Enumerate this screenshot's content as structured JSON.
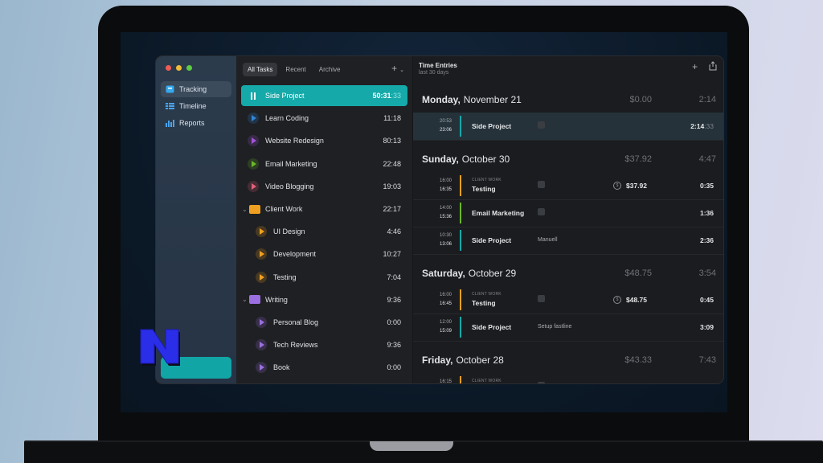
{
  "sidebar": {
    "items": [
      {
        "label": "Tracking",
        "icon": "tracking-icon",
        "active": true
      },
      {
        "label": "Timeline",
        "icon": "timeline-icon",
        "active": false
      },
      {
        "label": "Reports",
        "icon": "reports-icon",
        "active": false
      }
    ]
  },
  "tasks_panel": {
    "tabs": [
      {
        "label": "All Tasks",
        "active": true
      },
      {
        "label": "Recent",
        "active": false
      },
      {
        "label": "Archive",
        "active": false
      }
    ],
    "add_icon": "plus-icon",
    "tasks": [
      {
        "label": "Side Project",
        "time": "50:31",
        "time_sec": ":33",
        "color": "#16a9a9",
        "active": true,
        "type": "task",
        "indent": false
      },
      {
        "label": "Learn Coding",
        "time": "11:18",
        "color": "#2f86d6",
        "type": "task",
        "indent": false
      },
      {
        "label": "Website Redesign",
        "time": "80:13",
        "color": "#a055d6",
        "type": "task",
        "indent": false
      },
      {
        "label": "Email Marketing",
        "time": "22:48",
        "color": "#6ab82a",
        "type": "task",
        "indent": false
      },
      {
        "label": "Video Blogging",
        "time": "19:03",
        "color": "#e0617b",
        "type": "task",
        "indent": false
      },
      {
        "label": "Client Work",
        "time": "22:17",
        "color": "#f0a020",
        "type": "folder",
        "indent": false
      },
      {
        "label": "UI Design",
        "time": "4:46",
        "color": "#f0a020",
        "type": "task",
        "indent": true
      },
      {
        "label": "Development",
        "time": "10:27",
        "color": "#f0a020",
        "type": "task",
        "indent": true
      },
      {
        "label": "Testing",
        "time": "7:04",
        "color": "#f0a020",
        "type": "task",
        "indent": true
      },
      {
        "label": "Writing",
        "time": "9:36",
        "color": "#9b6fe0",
        "type": "folder",
        "indent": false
      },
      {
        "label": "Personal Blog",
        "time": "0:00",
        "color": "#9b6fe0",
        "type": "task",
        "indent": true
      },
      {
        "label": "Tech Reviews",
        "time": "9:36",
        "color": "#9b6fe0",
        "type": "task",
        "indent": true
      },
      {
        "label": "Book",
        "time": "0:00",
        "color": "#9b6fe0",
        "type": "task",
        "indent": true
      }
    ]
  },
  "entries_panel": {
    "title": "Time Entries",
    "subtitle": "last 30 days",
    "days": [
      {
        "weekday": "Monday,",
        "date": "November 21",
        "amount": "$0.00",
        "total": "2:14",
        "entries": [
          {
            "start": "20:53",
            "end": "23:06",
            "group": "",
            "name": "Side Project",
            "note": "",
            "note_icon": true,
            "money": "",
            "duration": "2:14",
            "duration_sec": ":33",
            "color": "#16a9a9",
            "highlight": true
          }
        ]
      },
      {
        "weekday": "Sunday,",
        "date": "October 30",
        "amount": "$37.92",
        "total": "4:47",
        "entries": [
          {
            "start": "16:00",
            "end": "16:35",
            "group": "CLIENT WORK",
            "name": "Testing",
            "note": "",
            "note_icon": true,
            "money": "$37.92",
            "duration": "0:35",
            "duration_sec": "",
            "color": "#f0a020"
          },
          {
            "start": "14:00",
            "end": "15:36",
            "group": "",
            "name": "Email Marketing",
            "note": "",
            "note_icon": true,
            "money": "",
            "duration": "1:36",
            "duration_sec": "",
            "color": "#6ab82a"
          },
          {
            "start": "10:30",
            "end": "13:06",
            "group": "",
            "name": "Side Project",
            "note": "Manuell",
            "note_icon": false,
            "money": "",
            "duration": "2:36",
            "duration_sec": "",
            "color": "#16a9a9"
          }
        ]
      },
      {
        "weekday": "Saturday,",
        "date": "October 29",
        "amount": "$48.75",
        "total": "3:54",
        "entries": [
          {
            "start": "16:00",
            "end": "16:45",
            "group": "CLIENT WORK",
            "name": "Testing",
            "note": "",
            "note_icon": true,
            "money": "$48.75",
            "duration": "0:45",
            "duration_sec": "",
            "color": "#f0a020"
          },
          {
            "start": "12:00",
            "end": "15:09",
            "group": "",
            "name": "Side Project",
            "note": "Setup fastline",
            "note_icon": false,
            "money": "",
            "duration": "3:09",
            "duration_sec": "",
            "color": "#16a9a9"
          }
        ]
      },
      {
        "weekday": "Friday,",
        "date": "October 28",
        "amount": "$43.33",
        "total": "7:43",
        "entries": [
          {
            "start": "16:15",
            "end": "",
            "group": "CLIENT WORK",
            "name": "",
            "note": "",
            "note_icon": true,
            "money": "",
            "duration": "",
            "duration_sec": "",
            "color": "#f0a020"
          }
        ]
      }
    ]
  }
}
